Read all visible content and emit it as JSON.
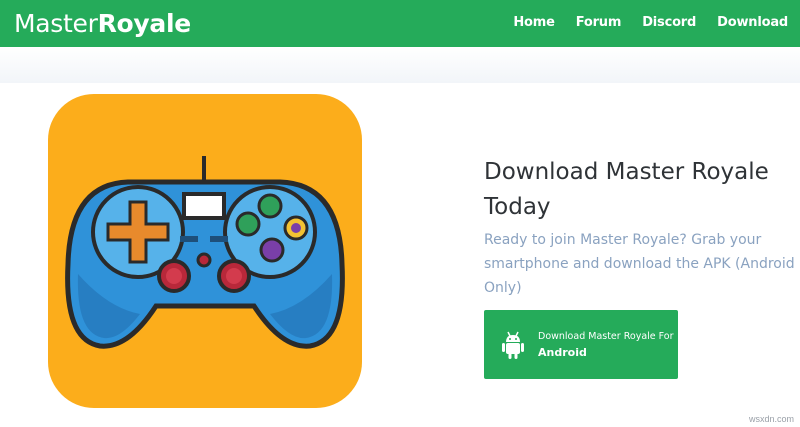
{
  "brand": {
    "part1": "Master",
    "part2": "Royale"
  },
  "nav": {
    "home": "Home",
    "forum": "Forum",
    "discord": "Discord",
    "download": "Download"
  },
  "hero": {
    "title": "Download Master Royale Today",
    "description": "Ready to join Master Royale? Grab your smartphone and download the APK (Android Only)",
    "button": {
      "line1": "Download Master Royale For",
      "line2": "Android"
    }
  },
  "watermark": "wsxdn.com",
  "colors": {
    "brand_green": "#25ab5a",
    "tile_orange": "#fcad1b",
    "gamepad_blue": "#2f92d9"
  }
}
